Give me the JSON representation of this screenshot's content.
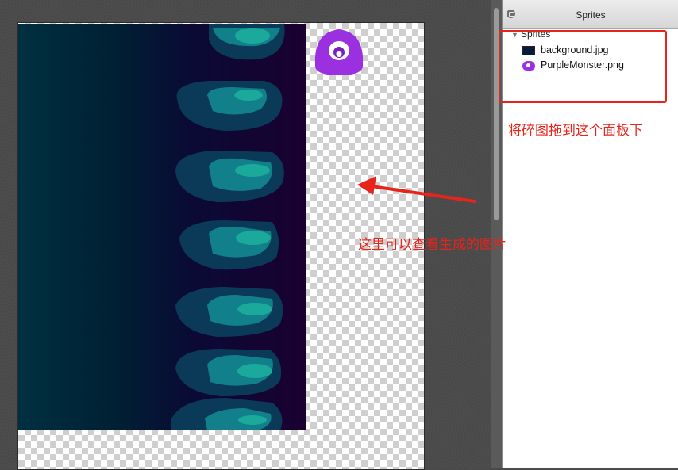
{
  "panel": {
    "title": "Sprites",
    "group_label": "Sprites",
    "items": [
      {
        "label": "background.jpg",
        "icon": "image-thumbnail-icon"
      },
      {
        "label": "PurpleMonster.png",
        "icon": "monster-thumbnail-icon"
      }
    ]
  },
  "annotations": {
    "drop_hint": "将碎图拖到这个面板下",
    "preview_hint": "这里可以查看生成的图片"
  },
  "colors": {
    "annotation": "#e8231a",
    "monster": "#9b30e0",
    "background_sprite_dark": "#003040"
  }
}
